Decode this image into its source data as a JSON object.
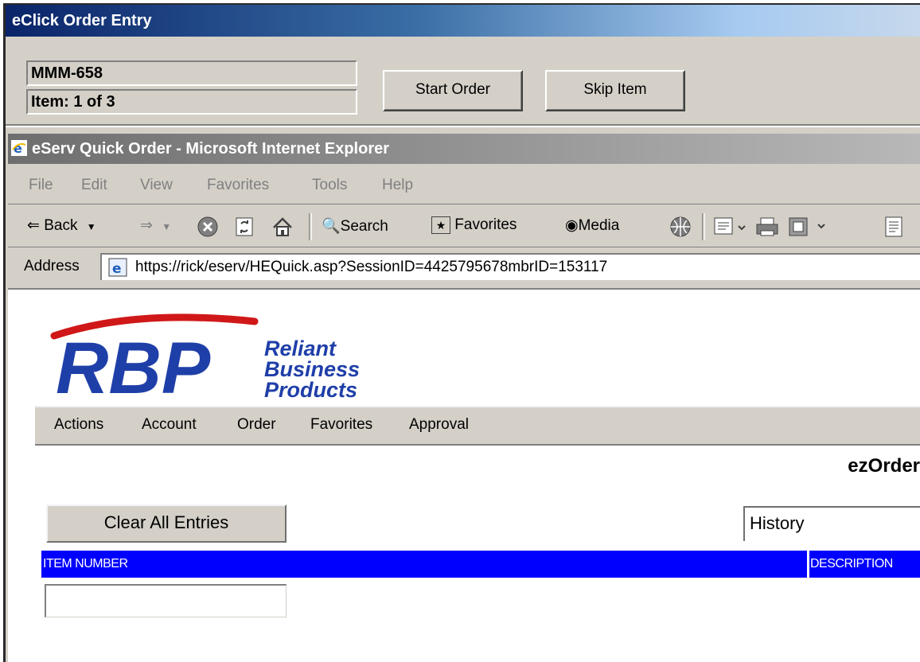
{
  "eclick": {
    "title": "eClick Order Entry",
    "order_id": "MMM-658",
    "item_progress": "Item: 1 of 3",
    "start_order": "Start Order",
    "skip_item": "Skip Item"
  },
  "ie": {
    "title": "eServ Quick Order - Microsoft Internet Explorer",
    "menu": [
      "File",
      "Edit",
      "View",
      "Favorites",
      "Tools",
      "Help"
    ],
    "toolbar": {
      "back": "Back",
      "search": "Search",
      "favorites": "Favorites",
      "media": "Media"
    },
    "address_label": "Address",
    "address_url": "https://rick/eserv/HEQuick.asp?SessionID=4425795678mbrID=153117"
  },
  "page": {
    "logo": {
      "letters": "RBP",
      "line1": "Reliant",
      "line2": "Business",
      "line3": "Products"
    },
    "nav": [
      "Actions",
      "Account",
      "Order",
      "Favorites",
      "Approval"
    ],
    "heading": "ezOrder",
    "clear_button": "Clear All Entries",
    "history_select": "History",
    "table": {
      "col_item": "ITEM NUMBER",
      "col_desc": "DESCRIPTION"
    },
    "item_input_value": ""
  },
  "colors": {
    "titlebar_active": "#0a246a",
    "table_header": "#0000ff",
    "logo_blue": "#1f3fa8",
    "logo_red": "#d01818",
    "chrome": "#d4d0c8"
  }
}
